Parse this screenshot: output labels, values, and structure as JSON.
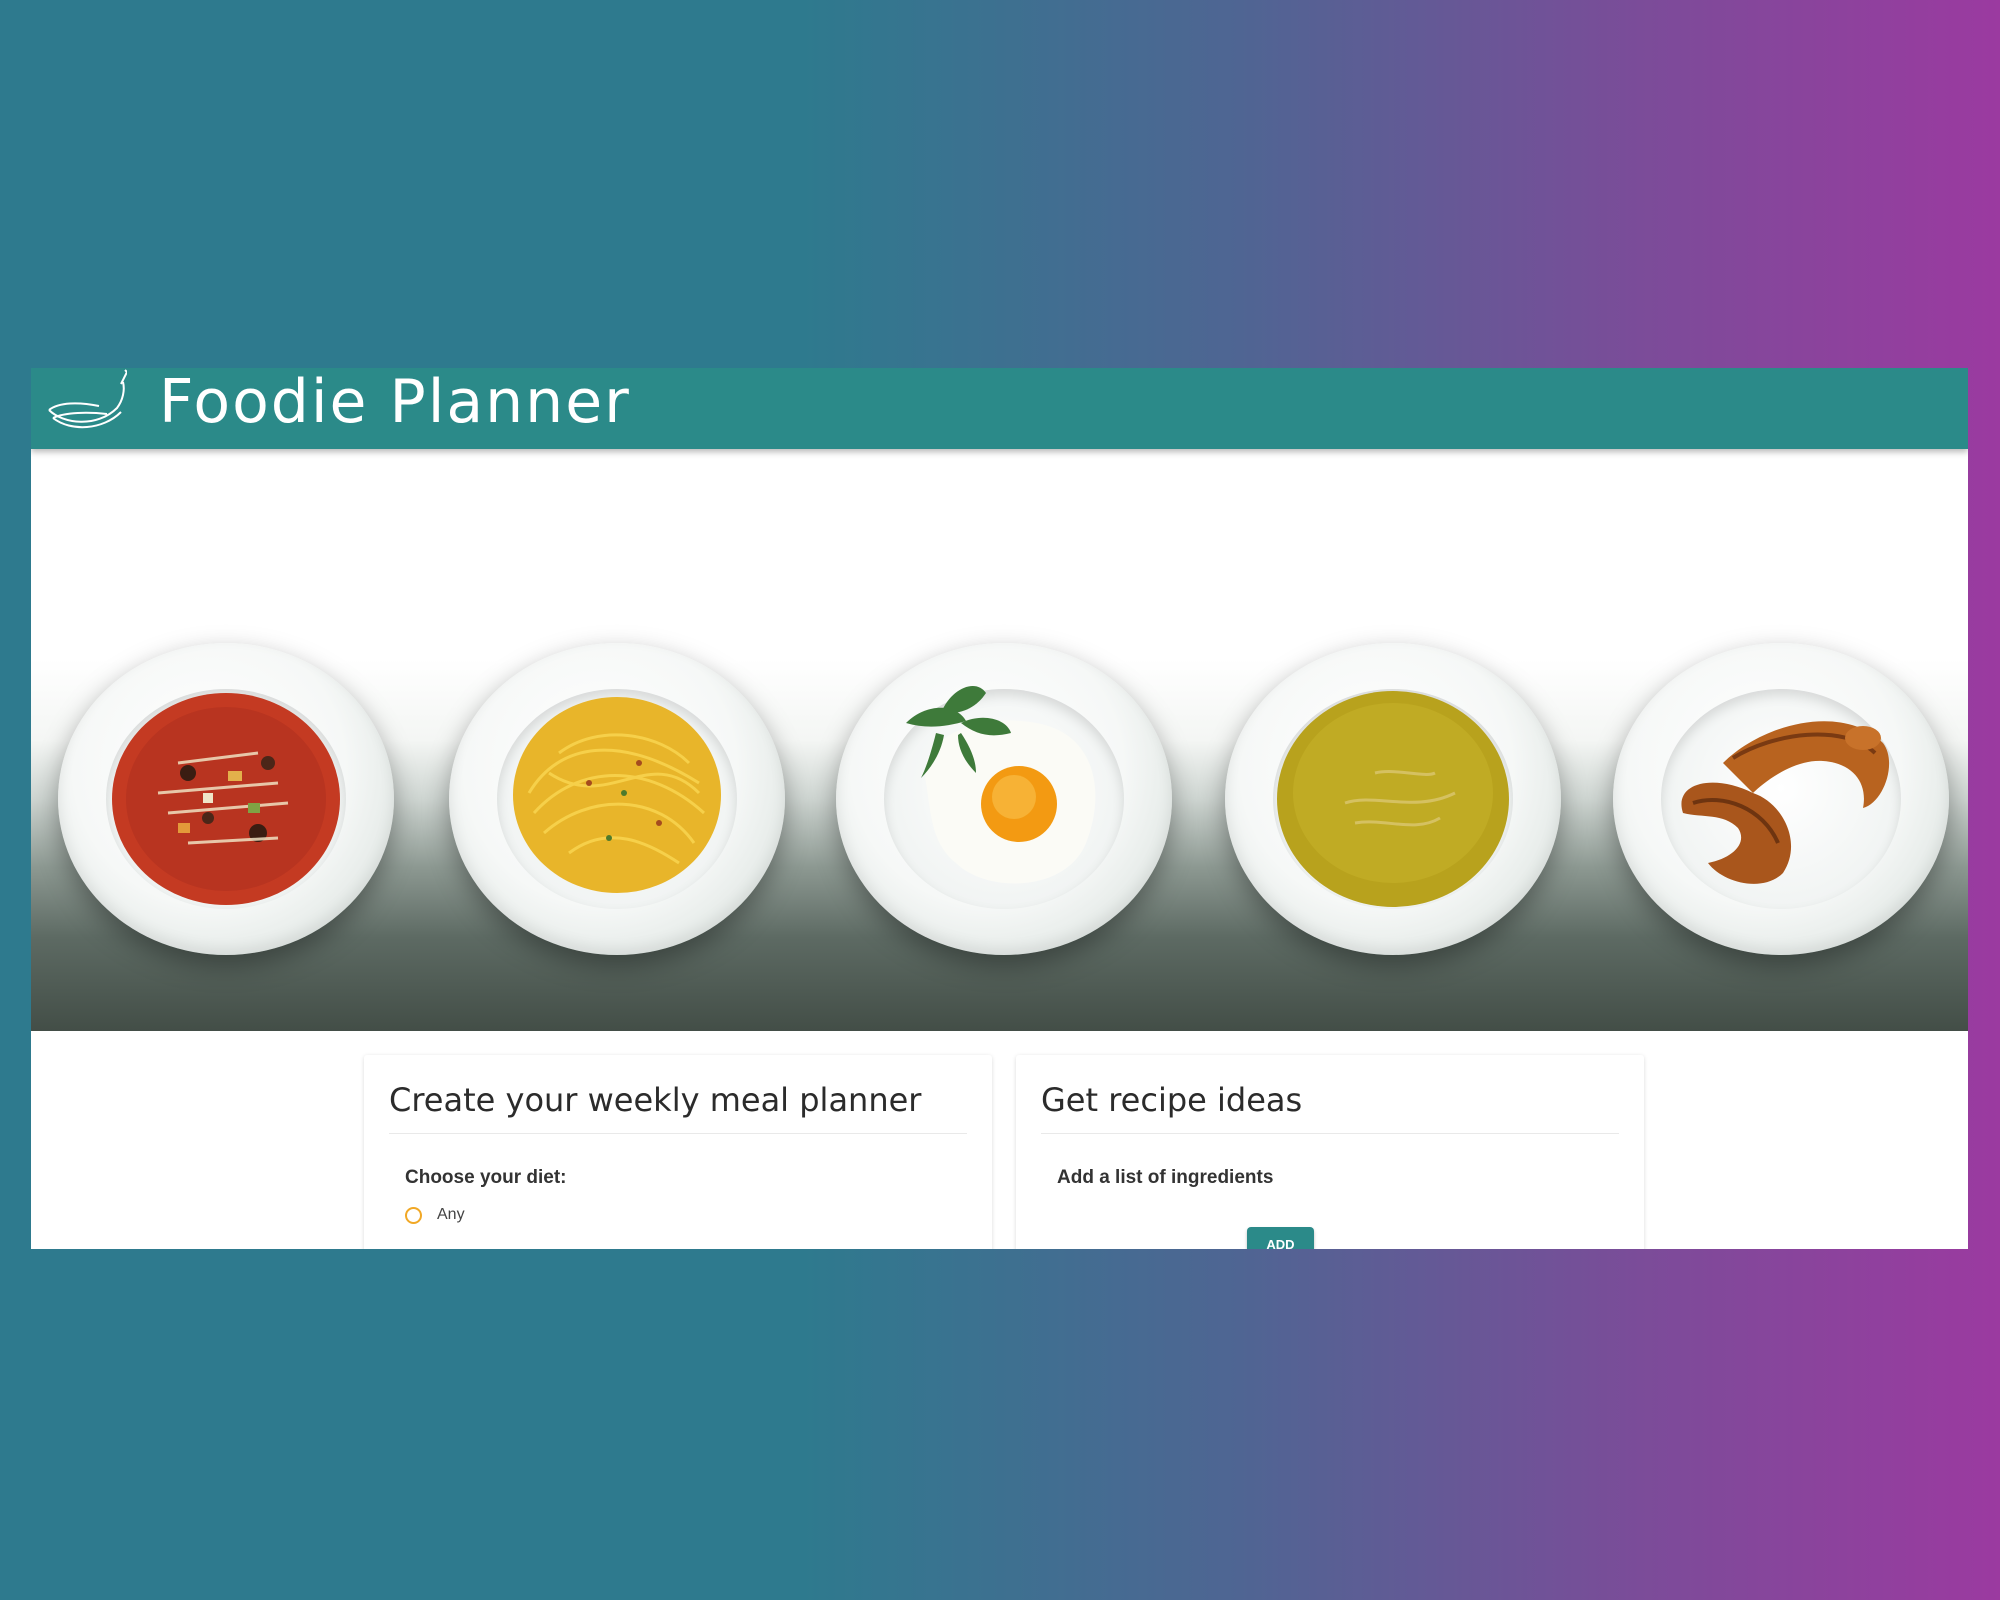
{
  "app": {
    "title": "Foodie Planner",
    "logo_icon": "banana-icon"
  },
  "hero": {
    "plates": [
      {
        "name": "soup-plate",
        "icon": "minestrone-soup"
      },
      {
        "name": "spaghetti-plate",
        "icon": "spaghetti"
      },
      {
        "name": "egg-plate",
        "icon": "fried-egg-with-mint"
      },
      {
        "name": "cream-soup-plate",
        "icon": "cream-soup"
      },
      {
        "name": "croissant-plate",
        "icon": "croissants"
      }
    ]
  },
  "planner_card": {
    "title": "Create your weekly meal planner",
    "diet_label": "Choose your diet:",
    "diet_options": [
      "Any"
    ]
  },
  "recipe_card": {
    "title": "Get recipe ideas",
    "ingredients_label": "Add a list of ingredients",
    "add_button": "ADD"
  },
  "colors": {
    "header": "#2b8a89",
    "accent_radio": "#f1a826",
    "background_start": "#2e7a8e",
    "background_end": "#9b3aa0"
  }
}
